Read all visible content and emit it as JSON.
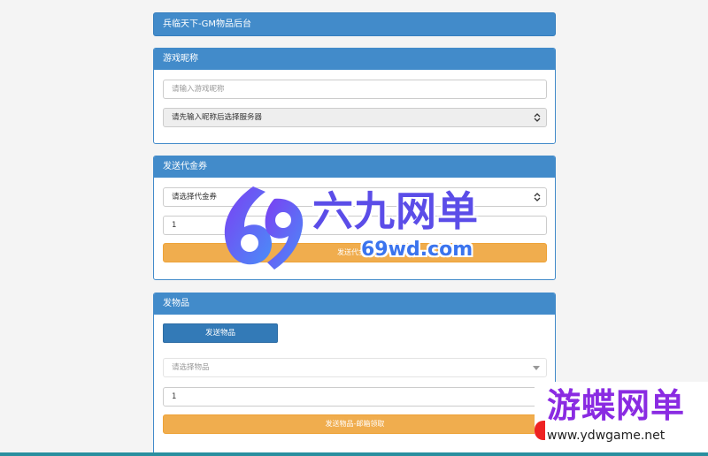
{
  "header": {
    "title": "兵临天下-GM物品后台"
  },
  "nickname_panel": {
    "heading": "游戏昵称",
    "nickname_placeholder": "请输入游戏昵称",
    "server_select_value": "请先输入昵称后选择服务器"
  },
  "voucher_panel": {
    "heading": "发送代金券",
    "voucher_select_value": "请选择代金券",
    "quantity_value": "1",
    "send_button": "发送代金券"
  },
  "item_panel": {
    "heading": "发物品",
    "send_items_tab": "发送物品",
    "item_select_placeholder": "请选择物品",
    "quantity_value": "1",
    "send_button": "发送物品-邮箱领取"
  },
  "watermark": {
    "brand": "六九网单",
    "brand_url": "69wd.com",
    "corner_brand": "游蝶网单",
    "corner_url": "www.ydwgame.net"
  },
  "colors": {
    "primary": "#428bca",
    "warning": "#f0ad4e",
    "button_blue": "#337ab7"
  }
}
